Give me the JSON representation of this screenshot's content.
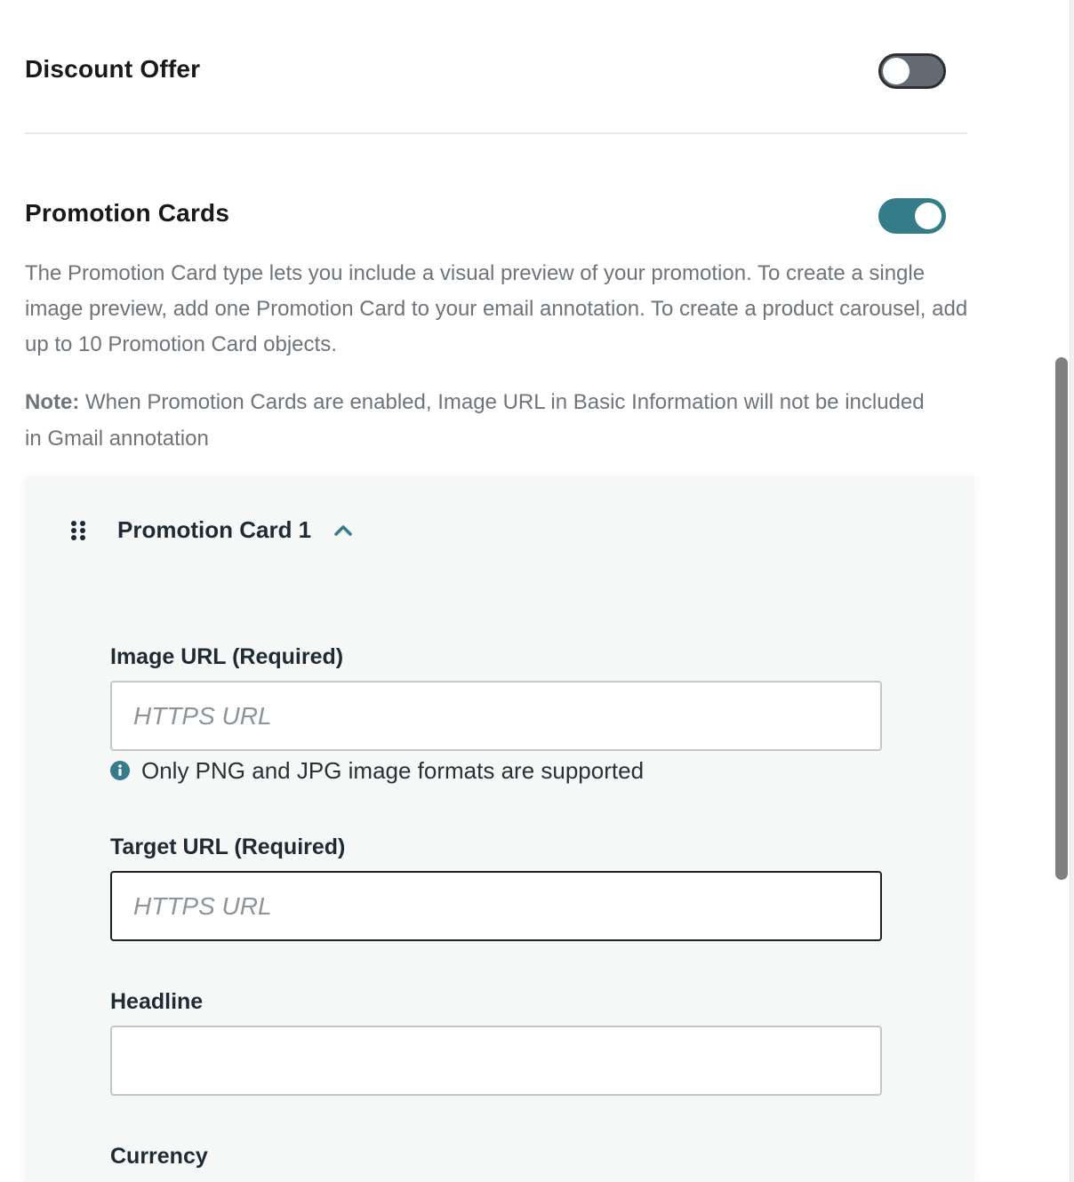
{
  "discount_offer": {
    "title": "Discount Offer",
    "enabled": false
  },
  "promotion_cards": {
    "title": "Promotion Cards",
    "enabled": true,
    "description": "The Promotion Card type lets you include a visual preview of your promotion. To create a single image preview, add one Promotion Card to your email annotation. To create a product carousel, add up to 10 Promotion Card objects.",
    "note_label": "Note:",
    "note_text": " When Promotion Cards are enabled, Image URL in Basic Information will not be included in Gmail annotation"
  },
  "card": {
    "title": "Promotion Card 1",
    "expanded": true,
    "fields": {
      "image_url": {
        "label": "Image URL (Required)",
        "placeholder": "HTTPS URL",
        "value": "",
        "hint": "Only PNG and JPG image formats are supported"
      },
      "target_url": {
        "label": "Target URL (Required)",
        "placeholder": "HTTPS URL",
        "value": ""
      },
      "headline": {
        "label": "Headline",
        "placeholder": "",
        "value": ""
      },
      "currency": {
        "label": "Currency"
      }
    }
  },
  "colors": {
    "accent": "#357c8a",
    "toggle_off": "#646b72",
    "text_primary": "#17191d",
    "text_secondary": "#6e7479",
    "panel_bg": "#f6f8f8"
  },
  "icons": {
    "drag": "drag-handle-icon",
    "collapse": "chevron-up-icon",
    "hint": "info-icon"
  }
}
